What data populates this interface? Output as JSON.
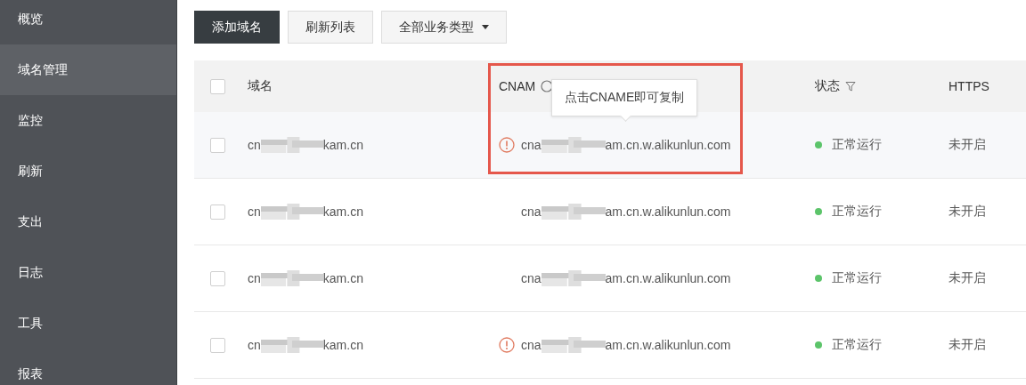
{
  "sidebar": {
    "items": [
      {
        "label": "概览",
        "selected": false
      },
      {
        "label": "域名管理",
        "selected": true
      },
      {
        "label": "监控",
        "selected": false
      },
      {
        "label": "刷新",
        "selected": false
      },
      {
        "label": "支出",
        "selected": false
      },
      {
        "label": "日志",
        "selected": false
      },
      {
        "label": "工具",
        "selected": false
      },
      {
        "label": "报表",
        "selected": false
      }
    ]
  },
  "toolbar": {
    "buttons": [
      {
        "kind": "primary",
        "label": "添加域名"
      },
      {
        "kind": "plain",
        "label": "刷新列表"
      },
      {
        "kind": "dropdown",
        "label": "全部业务类型"
      }
    ]
  },
  "table": {
    "columns": [
      {
        "kind": "checkbox",
        "checked": false
      },
      {
        "kind": "text",
        "label": "域名"
      },
      {
        "kind": "info",
        "label": "CNAM"
      },
      {
        "kind": "filter",
        "label": "状态"
      },
      {
        "kind": "text",
        "label": "HTTPS"
      }
    ],
    "rows": [
      {
        "highlighted": true,
        "checked": false,
        "domain_start": "cn",
        "domain_end": "kam.cn",
        "warning": true,
        "cname_start": "cna",
        "cname_end": "am.cn.w.alikunlun.com",
        "status": "正常运行",
        "color": "#5cc46a",
        "https": "未开启"
      },
      {
        "highlighted": false,
        "checked": false,
        "domain_start": "cn",
        "domain_end": "kam.cn",
        "warning": false,
        "cname_start": "cna",
        "cname_end": "am.cn.w.alikunlun.com",
        "status": "正常运行",
        "color": "#5cc46a",
        "https": "未开启"
      },
      {
        "highlighted": false,
        "checked": false,
        "domain_start": "cn",
        "domain_end": "kam.cn",
        "warning": false,
        "cname_start": "cna",
        "cname_end": "am.cn.w.alikunlun.com",
        "status": "正常运行",
        "color": "#5cc46a",
        "https": "未开启"
      },
      {
        "highlighted": false,
        "checked": false,
        "domain_start": "cn",
        "domain_end": "kam.cn",
        "warning": true,
        "cname_start": "cna",
        "cname_end": "am.cn.w.alikunlun.com",
        "status": "正常运行",
        "color": "#5cc46a",
        "https": "未开启"
      }
    ]
  },
  "tooltip": {
    "text": "点击CNAME即可复制"
  },
  "highlight_frame": {
    "shown": true
  }
}
